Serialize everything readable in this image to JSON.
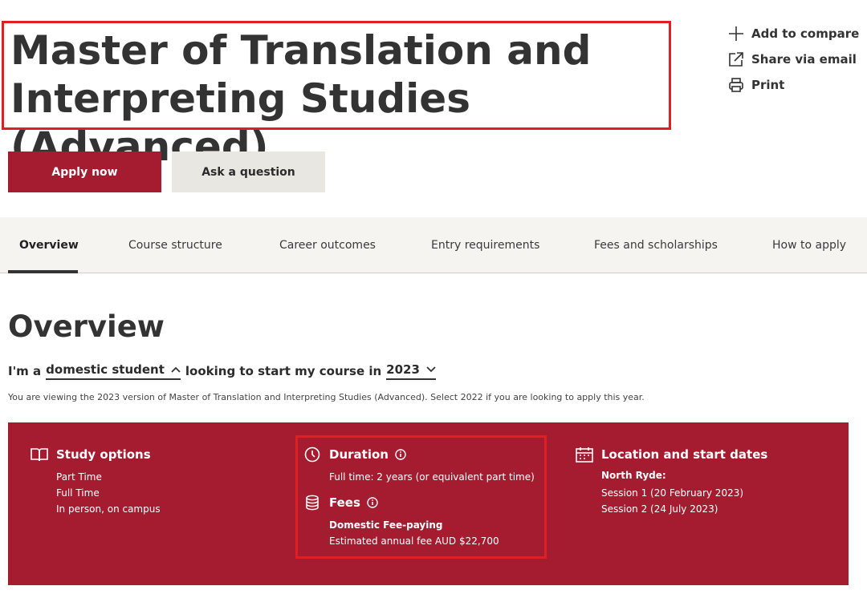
{
  "course": {
    "title_line1": "Master of Translation and",
    "title_line2": "Interpreting Studies (Advanced)"
  },
  "side_actions": {
    "compare": "Add to compare",
    "share": "Share via email",
    "print": "Print"
  },
  "buttons": {
    "apply": "Apply now",
    "ask": "Ask a question"
  },
  "tabs": [
    {
      "label": "Overview"
    },
    {
      "label": "Course structure"
    },
    {
      "label": "Career outcomes"
    },
    {
      "label": "Entry requirements"
    },
    {
      "label": "Fees and scholarships"
    },
    {
      "label": "How to apply"
    }
  ],
  "overview": {
    "heading": "Overview",
    "prefix": "I'm a",
    "student_type": "domestic student",
    "middle": "looking to start my course in",
    "year": "2023",
    "note": "You are viewing the 2023 version of Master of Translation and Interpreting Studies (Advanced). Select 2022 if you are looking to apply this year."
  },
  "panel": {
    "study_options": {
      "heading": "Study options",
      "items": [
        "Part Time",
        "Full Time",
        "In person, on campus"
      ]
    },
    "duration": {
      "heading": "Duration",
      "text": "Full time: 2 years (or equivalent part time)"
    },
    "fees": {
      "heading": "Fees",
      "subheading": "Domestic Fee-paying",
      "text": "Estimated annual fee AUD $22,700"
    },
    "location": {
      "heading": "Location and start dates",
      "campus": "North Ryde:",
      "sessions": [
        "Session 1 (20 February 2023)",
        "Session 2 (24 July 2023)"
      ]
    }
  },
  "colors": {
    "brand": "#a51c30",
    "button_secondary": "#e8e7e2",
    "tabbar": "#f5f4f0",
    "annotation": "#e02020"
  },
  "icons": [
    "plus-icon",
    "external-share-icon",
    "printer-icon",
    "chevron-up-icon",
    "chevron-down-icon",
    "book-icon",
    "clock-icon",
    "info-icon",
    "coins-icon",
    "calendar-icon"
  ]
}
